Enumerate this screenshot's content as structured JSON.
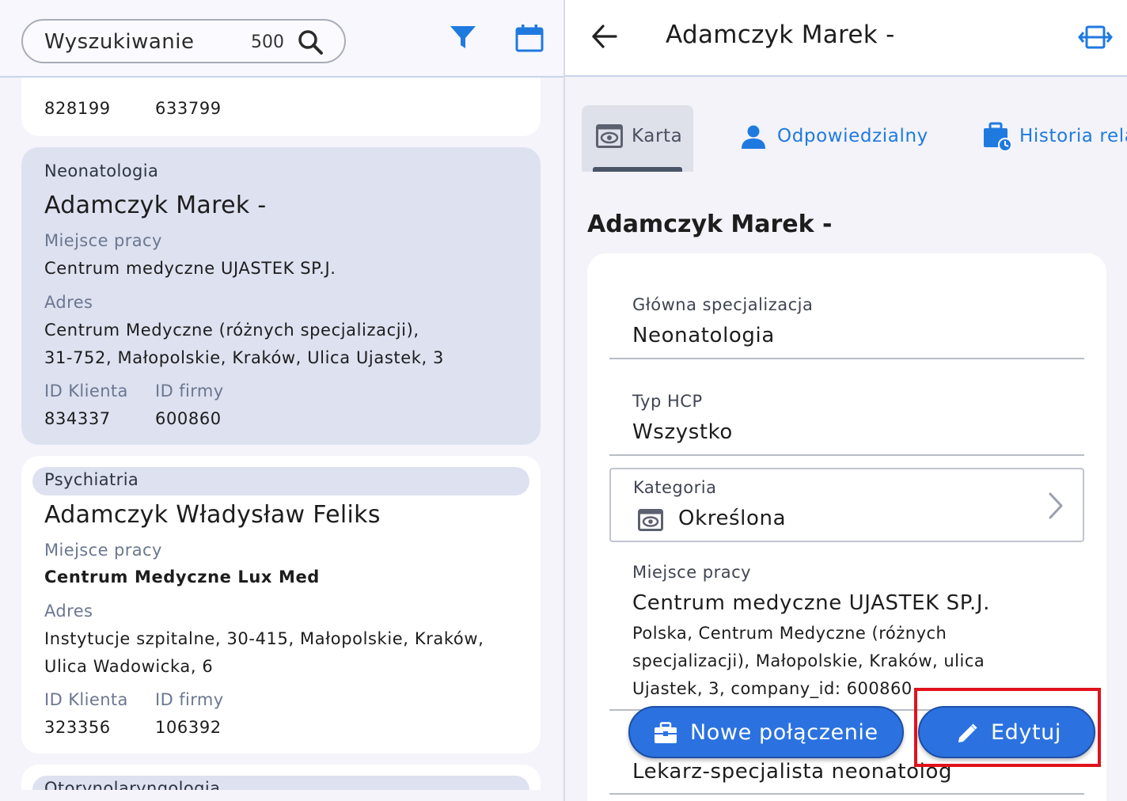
{
  "search": {
    "label": "Wyszukiwanie",
    "count": "500"
  },
  "list": {
    "partial_top": {
      "client_id": "828199",
      "company_id": "633799"
    },
    "cards": [
      {
        "specialization": "Neonatologia",
        "name": "Adamczyk Marek -",
        "workplace_label": "Miejsce pracy",
        "workplace": "Centrum medyczne UJASTEK SP.J.",
        "address_label": "Adres",
        "address_line1": "Centrum Medyczne (różnych specjalizacji),",
        "address_line2": "31-752, Małopolskie, Kraków, Ulica Ujastek, 3",
        "client_id_label": "ID Klienta",
        "company_id_label": "ID firmy",
        "client_id": "834337",
        "company_id": "600860"
      },
      {
        "specialization": "Psychiatria",
        "name": "Adamczyk Władysław Feliks",
        "workplace_label": "Miejsce pracy",
        "workplace": "Centrum Medyczne Lux Med",
        "address_label": "Adres",
        "address_line1": "Instytucje szpitalne, 30-415, Małopolskie, Kraków,",
        "address_line2": "Ulica Wadowicka, 6",
        "client_id_label": "ID Klienta",
        "company_id_label": "ID firmy",
        "client_id": "323356",
        "company_id": "106392"
      }
    ],
    "partial_bottom_specialization": "Otorynolaryngologia"
  },
  "detail": {
    "header_title": "Adamczyk Marek -",
    "tabs": [
      {
        "label": "Karta",
        "active": true
      },
      {
        "label": "Odpowiedzialny",
        "active": false
      },
      {
        "label": "Historia rela",
        "active": false
      }
    ],
    "section_title": "Adamczyk Marek -",
    "fields": {
      "main_spec_label": "Główna specjalizacja",
      "main_spec_value": "Neonatologia",
      "hcp_type_label": "Typ HCP",
      "hcp_type_value": "Wszystko",
      "category_label": "Kategoria",
      "category_value": "Określona",
      "workplace_label": "Miejsce pracy",
      "workplace_value": "Centrum medyczne UJASTEK SP.J.",
      "workplace_detail_line1": "Polska, Centrum Medyczne (różnych",
      "workplace_detail_line2": "specjalizacji), Małopolskie, Kraków, ulica",
      "workplace_detail_line3": "Ujastek, 3, company_id: 600860",
      "bottom_value": "Lekarz-specjalista neonatolog"
    },
    "actions": {
      "new_connection": "Nowe połączenie",
      "edit": "Edytuj"
    }
  },
  "colors": {
    "accent_blue": "#1f7ae0",
    "fab_blue": "#2b72e0",
    "selected_card": "#dde1f0",
    "highlight_red": "#e0121b"
  }
}
